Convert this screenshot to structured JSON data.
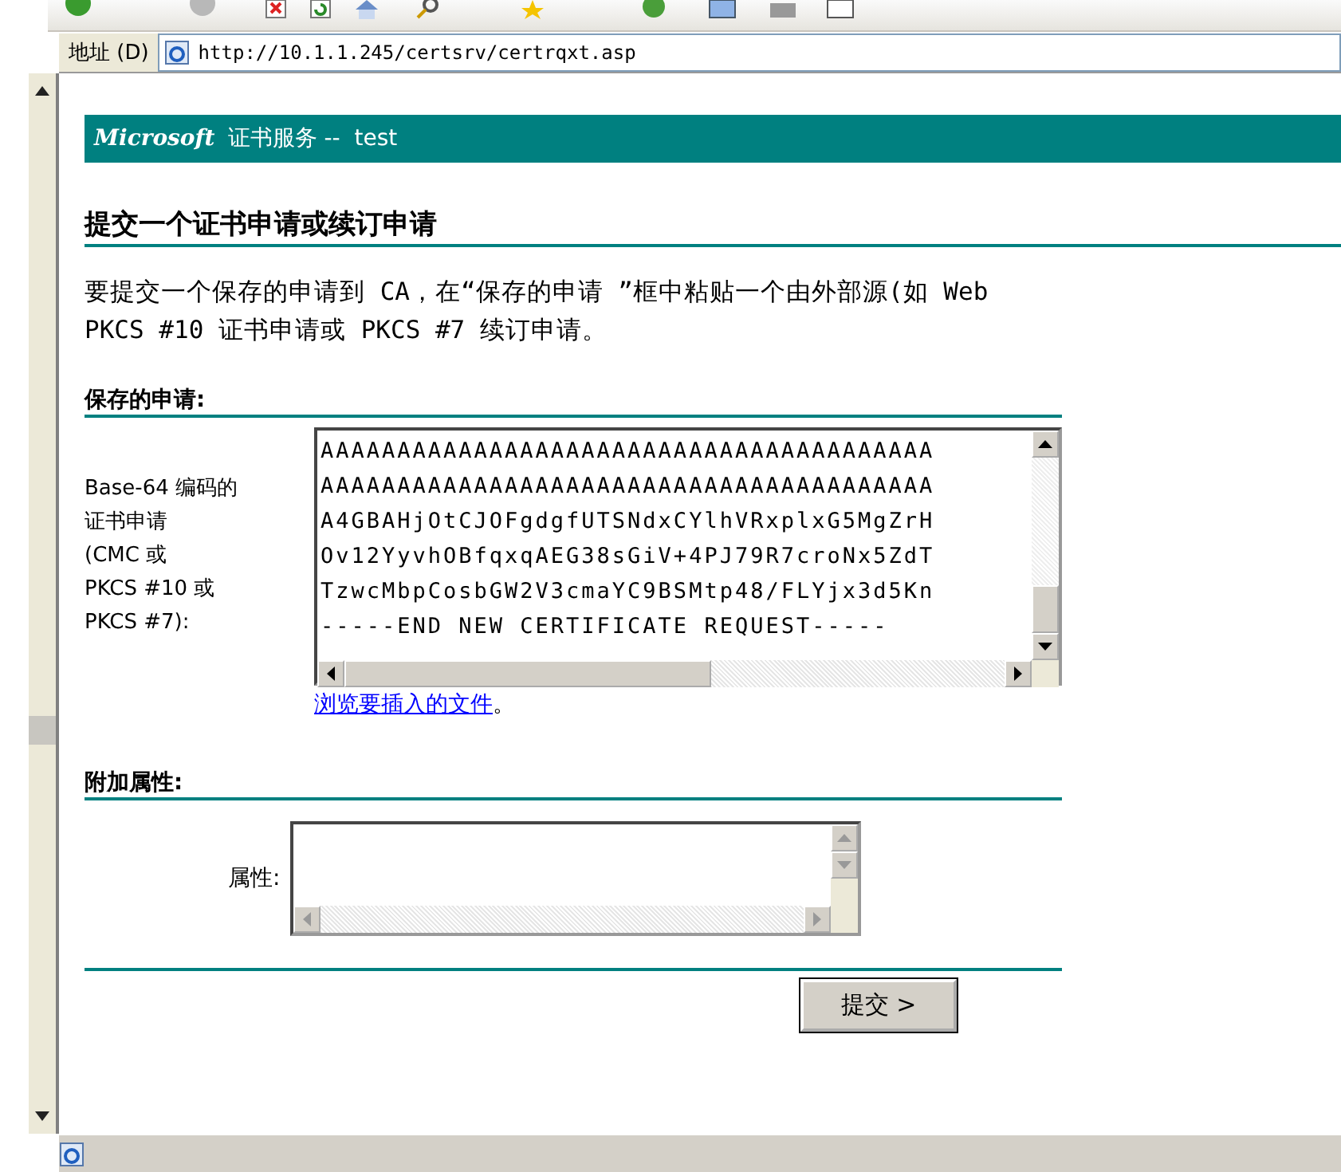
{
  "address_bar": {
    "label": "地址 (D)",
    "url": "http://10.1.1.245/certsrv/certrqxt.asp"
  },
  "banner": {
    "brand": "Microsoft",
    "title": "证书服务 --  test"
  },
  "heading": "提交一个证书申请或续订申请",
  "intro": [
    "要提交一个保存的申请到 CA，在“保存的申请 ”框中粘贴一个由外部源(如 Web",
    "PKCS #10 证书申请或 PKCS #7 续订申请。"
  ],
  "saved_request": {
    "title": "保存的申请:",
    "label": [
      "Base-64 编码的",
      "证书申请",
      "(CMC 或",
      "PKCS #10 或",
      "PKCS #7):"
    ],
    "lines": [
      "AAAAAAAAAAAAAAAAAAAAAAAAAAAAAAAAAAAAAAAA",
      "AAAAAAAAAAAAAAAAAAAAAAAAAAAAAAAAAAAAAAAA",
      "A4GBAHjOtCJOFgdgfUTSNdxCYlhVRxplxG5MgZrH",
      "Ov12YyvhOBfqxqAEG38sGiV+4PJ79R7croNx5ZdT",
      "TzwcMbpCosbGW2V3cmaYC9BSMtp48/FLYjx3d5Kn",
      "-----END NEW CERTIFICATE REQUEST-----"
    ],
    "browse_link": "浏览要插入的文件",
    "link_suffix": "。"
  },
  "attributes": {
    "title": "附加属性:",
    "label": "属性:"
  },
  "submit": "提交 >"
}
